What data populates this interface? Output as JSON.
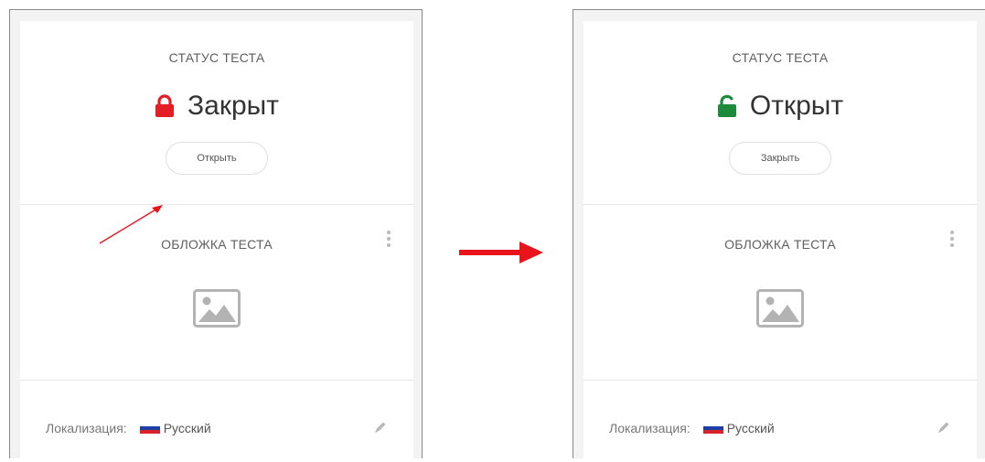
{
  "screens": [
    {
      "status_title": "СТАТУС ТЕСТА",
      "state_label": "Закрыт",
      "lock_icon": "lock-closed-icon",
      "lock_color": "#e31e24",
      "action_label": "Открыть",
      "cover_title": "ОБЛОЖКА ТЕСТА",
      "locale_label": "Локализация:",
      "language": "Русский"
    },
    {
      "status_title": "СТАТУС ТЕСТА",
      "state_label": "Открыт",
      "lock_icon": "lock-open-icon",
      "lock_color": "#1b8a3a",
      "action_label": "Закрыть",
      "cover_title": "ОБЛОЖКА ТЕСТА",
      "locale_label": "Локализация:",
      "language": "Русский"
    }
  ],
  "colors": {
    "annotation_red": "#e8131b",
    "flag": [
      "#ffffff",
      "#1c3fa8",
      "#d8232a"
    ]
  },
  "icons": {
    "menu": "kebab-menu-icon",
    "cover": "image-placeholder-icon",
    "edit": "pencil-icon",
    "transition": "right-arrow-icon"
  }
}
